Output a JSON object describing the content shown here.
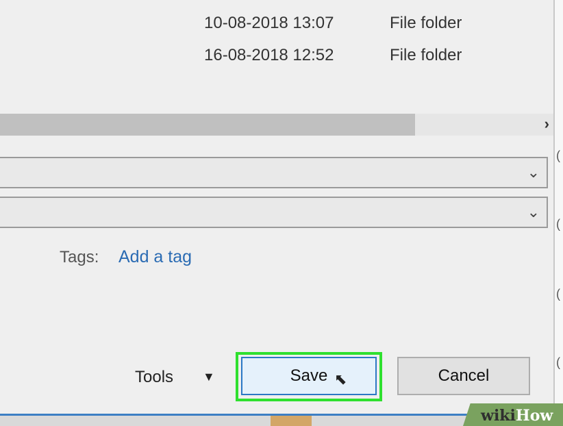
{
  "file_list": {
    "rows": [
      {
        "date": "10-08-2018 13:07",
        "type": "File folder"
      },
      {
        "date": "16-08-2018 12:52",
        "type": "File folder"
      }
    ]
  },
  "scrollbar": {
    "arrow_icon": "chevron-right-icon"
  },
  "file_name_combo": {
    "value": "",
    "icon": "chevron-down-icon"
  },
  "save_as_type_combo": {
    "value": "",
    "icon": "chevron-down-icon"
  },
  "tags": {
    "label": "Tags:",
    "link": "Add a tag"
  },
  "footer": {
    "tools_label": "Tools",
    "save_label": "Save",
    "cancel_label": "Cancel"
  },
  "watermark": {
    "text_wiki": "wiki",
    "text_how": "How"
  },
  "colors": {
    "accent_blue": "#2b78c5",
    "link_blue": "#2a6bb3",
    "highlight_green": "#2fe02f"
  }
}
